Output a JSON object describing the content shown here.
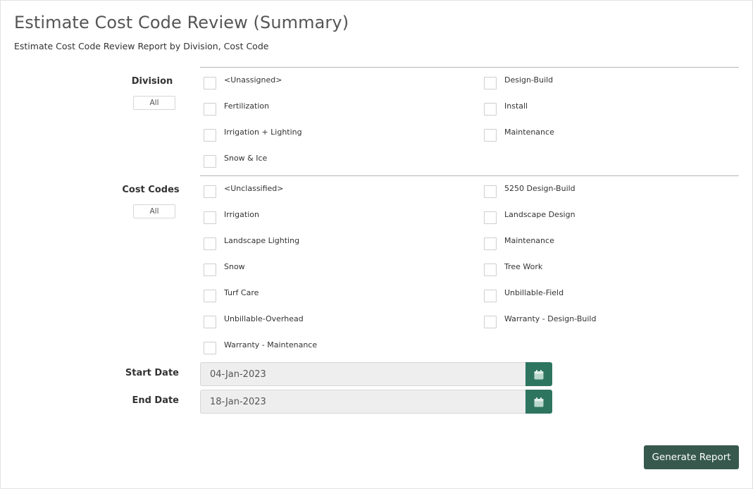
{
  "page": {
    "title": "Estimate Cost Code Review (Summary)",
    "subtitle": "Estimate Cost Code Review Report by Division, Cost Code"
  },
  "division": {
    "label": "Division",
    "all_label": "All",
    "items": [
      "<Unassigned>",
      "Design-Build",
      "Fertilization",
      "Install",
      "Irrigation + Lighting",
      "Maintenance",
      "Snow & Ice"
    ]
  },
  "cost_codes": {
    "label": "Cost Codes",
    "all_label": "All",
    "items": [
      "<Unclassified>",
      "5250 Design-Build",
      "Irrigation",
      "Landscape Design",
      "Landscape Lighting",
      "Maintenance",
      "Snow",
      "Tree Work",
      "Turf Care",
      "Unbillable-Field",
      "Unbillable-Overhead",
      "Warranty - Design-Build",
      "Warranty - Maintenance"
    ]
  },
  "dates": {
    "start_label": "Start Date",
    "start_value": "04-Jan-2023",
    "end_label": "End Date",
    "end_value": "18-Jan-2023",
    "icon": "calendar-icon"
  },
  "actions": {
    "generate_label": "Generate Report"
  },
  "colors": {
    "accent": "#2e7560",
    "generate_button": "#37594d",
    "input_bg": "#eeeeee"
  }
}
